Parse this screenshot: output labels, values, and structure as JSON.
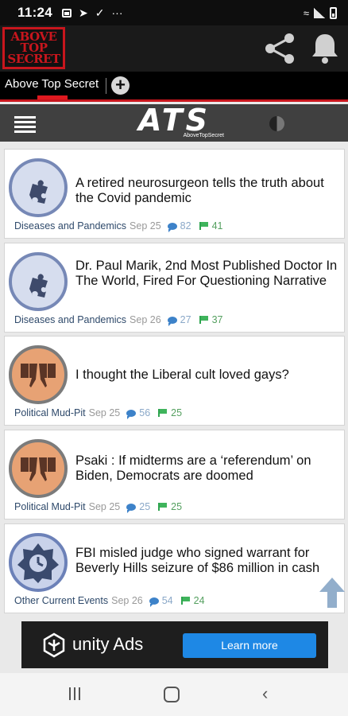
{
  "status_bar": {
    "time": "11:24",
    "more": "···"
  },
  "header": {
    "logo_lines": [
      "ABOVE",
      "TOP",
      "SECRET"
    ],
    "share": "share-icon",
    "notifications": "bell-icon"
  },
  "tabs": {
    "active_label": "Above Top Secret",
    "add_label": "+"
  },
  "nav": {
    "logo_text": "ATS",
    "logo_sub": "AboveTopSecret"
  },
  "feed": [
    {
      "title": "A retired neurosurgeon tells the truth about the Covid pandemic",
      "category": "Diseases and Pandemics",
      "date": "Sep 25",
      "replies": "82",
      "flags": "41",
      "icon": "puzzle-icon"
    },
    {
      "title": "Dr. Paul Marik, 2nd Most Published Doctor In The World, Fired For Questioning Narrative",
      "category": "Diseases and Pandemics",
      "date": "Sep 26",
      "replies": "27",
      "flags": "37",
      "icon": "puzzle-icon"
    },
    {
      "title": "I thought the Liberal cult loved gays?",
      "category": "Political Mud-Pit",
      "date": "Sep 25",
      "replies": "56",
      "flags": "25",
      "icon": "thumbs-down-icon"
    },
    {
      "title": "Psaki : If midterms are a ‘referendum’ on Biden, Democrats are doomed",
      "category": "Political Mud-Pit",
      "date": "Sep 25",
      "replies": "25",
      "flags": "25",
      "icon": "thumbs-down-icon"
    },
    {
      "title": "FBI misled judge who signed warrant for Beverly Hills seizure of $86 million in cash",
      "category": "Other Current Events",
      "date": "Sep 26",
      "replies": "54",
      "flags": "24",
      "icon": "clock-badge-icon"
    }
  ],
  "ad": {
    "brand": "unity Ads",
    "cta": "Learn more"
  },
  "colors": {
    "accent": "#c8161d",
    "cta": "#1e88e5"
  }
}
